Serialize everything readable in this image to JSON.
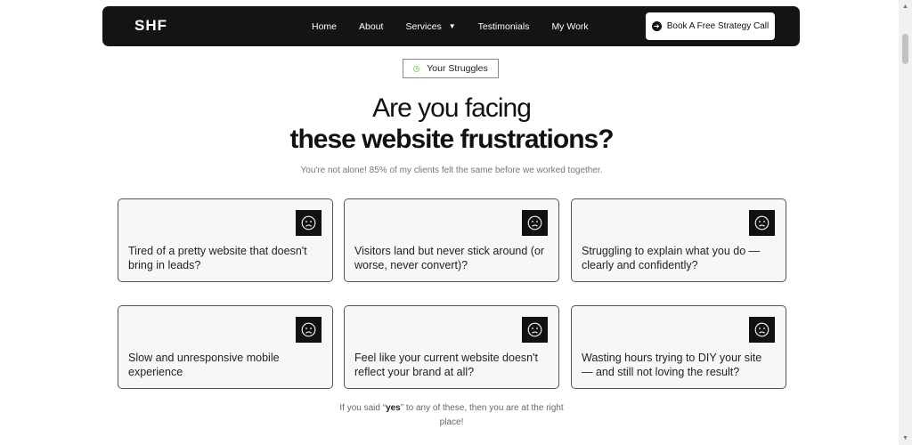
{
  "nav": {
    "logo": "SHF",
    "links": [
      "Home",
      "About",
      "Services",
      "Testimonials",
      "My Work"
    ],
    "cta_label": "Book A Free Strategy Call"
  },
  "badge": {
    "label": "Your Struggles"
  },
  "heading": {
    "line1": "Are you facing",
    "line2": "these website frustrations?",
    "subtitle": "You're not alone! 85% of my clients felt the same before we worked together."
  },
  "cards": [
    {
      "text": "Tired of a pretty website that doesn't bring in leads?",
      "icon": "sad-face-icon"
    },
    {
      "text": "Visitors land but never stick around (or worse, never convert)?",
      "icon": "sad-face-icon"
    },
    {
      "text": "Struggling to explain what you do — clearly and confidently?",
      "icon": "sad-face-icon"
    },
    {
      "text": "Slow and unresponsive mobile experience",
      "icon": "sad-face-icon"
    },
    {
      "text": "Feel like your current website doesn't reflect your brand at all?",
      "icon": "sad-face-icon"
    },
    {
      "text": "Wasting hours trying to DIY your site — and still not loving the result?",
      "icon": "sad-face-icon"
    }
  ],
  "footer": {
    "prefix": "If you said “",
    "emphasis": "yes",
    "suffix": "” to any of these, then you are at the right place!"
  },
  "colors": {
    "dark": "#141414",
    "accent": "#8fd36a",
    "card_bg": "#f7f7f7"
  }
}
